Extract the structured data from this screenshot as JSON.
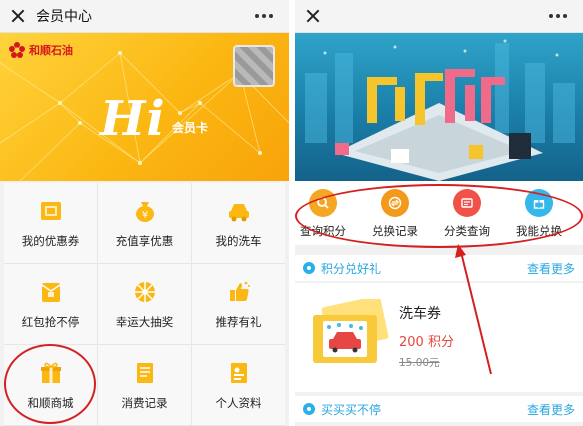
{
  "left_screen": {
    "topbar": {
      "title": "会员中心"
    },
    "banner": {
      "brand": "和顺石油",
      "greeting": "Hi",
      "card_label": "会员卡"
    },
    "grid": [
      {
        "label": "我的优惠券",
        "icon": "coupon-icon"
      },
      {
        "label": "充值享优惠",
        "icon": "money-bag-icon"
      },
      {
        "label": "我的洗车",
        "icon": "car-icon"
      },
      {
        "label": "红包抢不停",
        "icon": "red-envelope-icon"
      },
      {
        "label": "幸运大抽奖",
        "icon": "lottery-wheel-icon"
      },
      {
        "label": "推荐有礼",
        "icon": "thumbs-up-icon"
      },
      {
        "label": "和顺商城",
        "icon": "gift-icon"
      },
      {
        "label": "消费记录",
        "icon": "receipt-icon"
      },
      {
        "label": "个人资料",
        "icon": "profile-card-icon"
      }
    ]
  },
  "right_screen": {
    "menu": [
      {
        "label": "查询积分",
        "icon": "search-icon",
        "color": "#f5a623"
      },
      {
        "label": "兑换记录",
        "icon": "exchange-icon",
        "color": "#f39a1c"
      },
      {
        "label": "分类查询",
        "icon": "category-icon",
        "color": "#f0524a"
      },
      {
        "label": "我能兑换",
        "icon": "gift-box-icon",
        "color": "#35b7ea"
      }
    ],
    "section_points": {
      "title": "积分兑好礼",
      "more": "查看更多"
    },
    "product": {
      "name": "洗车券",
      "points": "200 积分",
      "original_price": "15.00元"
    },
    "section_buy": {
      "title": "买买买不停",
      "more": "查看更多"
    }
  },
  "colors": {
    "accent_yellow": "#fbb712",
    "accent_blue": "#29a7df",
    "annotation_red": "#d42020"
  }
}
